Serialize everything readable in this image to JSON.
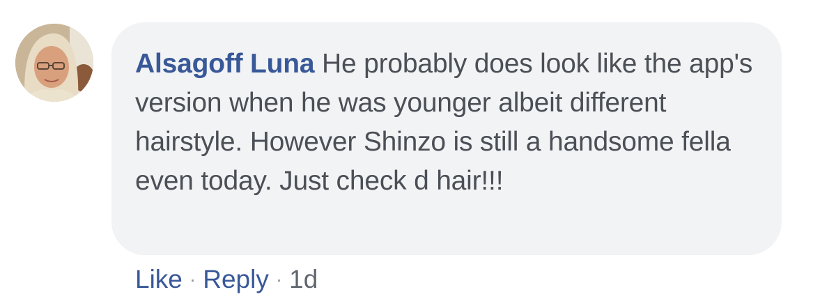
{
  "comment": {
    "author": "Alsagoff Luna",
    "text": "He probably does look like the app's version when he was younger albeit different hairstyle. However Shinzo is still a handsome fella even today. Just check d hair!!!",
    "actions": {
      "like_label": "Like",
      "separator": "·",
      "reply_label": "Reply",
      "timestamp": "1d"
    }
  },
  "colors": {
    "bubble_background": "#f2f3f5",
    "author_link": "#385898",
    "body_text": "#4b4f56",
    "timestamp": "#606770"
  },
  "icons": {
    "avatar": "profile-photo"
  }
}
